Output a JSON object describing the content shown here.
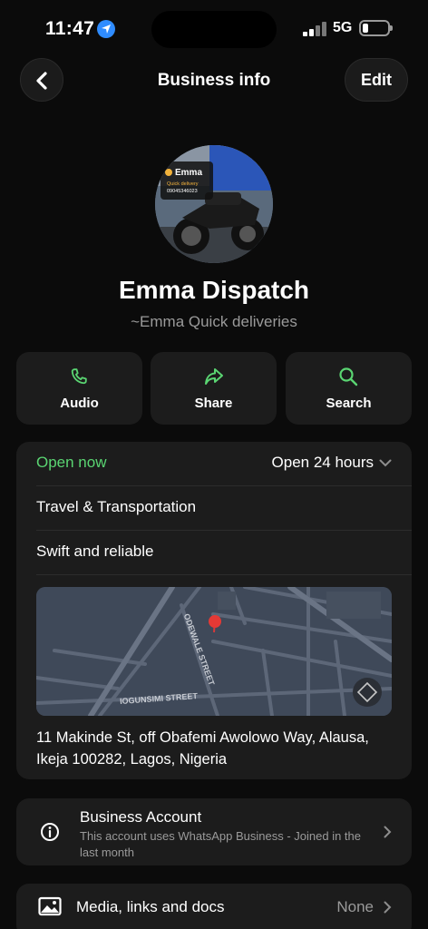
{
  "status_bar": {
    "time": "11:47",
    "network": "5G"
  },
  "header": {
    "title": "Business info",
    "edit_label": "Edit"
  },
  "profile": {
    "name": "Emma Dispatch",
    "subtitle": "~Emma Quick deliveries",
    "avatar_logo_text": "Emma",
    "avatar_logo_sub": "Quick delivery",
    "avatar_logo_phone": "09045346023"
  },
  "actions": [
    {
      "label": "Audio",
      "icon": "phone-icon"
    },
    {
      "label": "Share",
      "icon": "share-icon"
    },
    {
      "label": "Search",
      "icon": "search-icon"
    }
  ],
  "info": {
    "status": "Open now",
    "hours": "Open 24 hours",
    "category": "Travel & Transportation",
    "description": "Swift and reliable",
    "map_streets": [
      "ODEWALE STREET",
      "IOGUNSIMI STREET"
    ],
    "address": "11 Makinde St, off Obafemi Awolowo Way, Alausa, Ikeja 100282, Lagos, Nigeria"
  },
  "business_account": {
    "title": "Business Account",
    "description": "This account uses WhatsApp Business - Joined in the last month"
  },
  "media": {
    "title": "Media, links and docs",
    "value": "None"
  },
  "colors": {
    "accent_green": "#5ad572",
    "background": "#0b0b0b",
    "card": "#1c1c1c",
    "muted": "#9a9a9a"
  }
}
